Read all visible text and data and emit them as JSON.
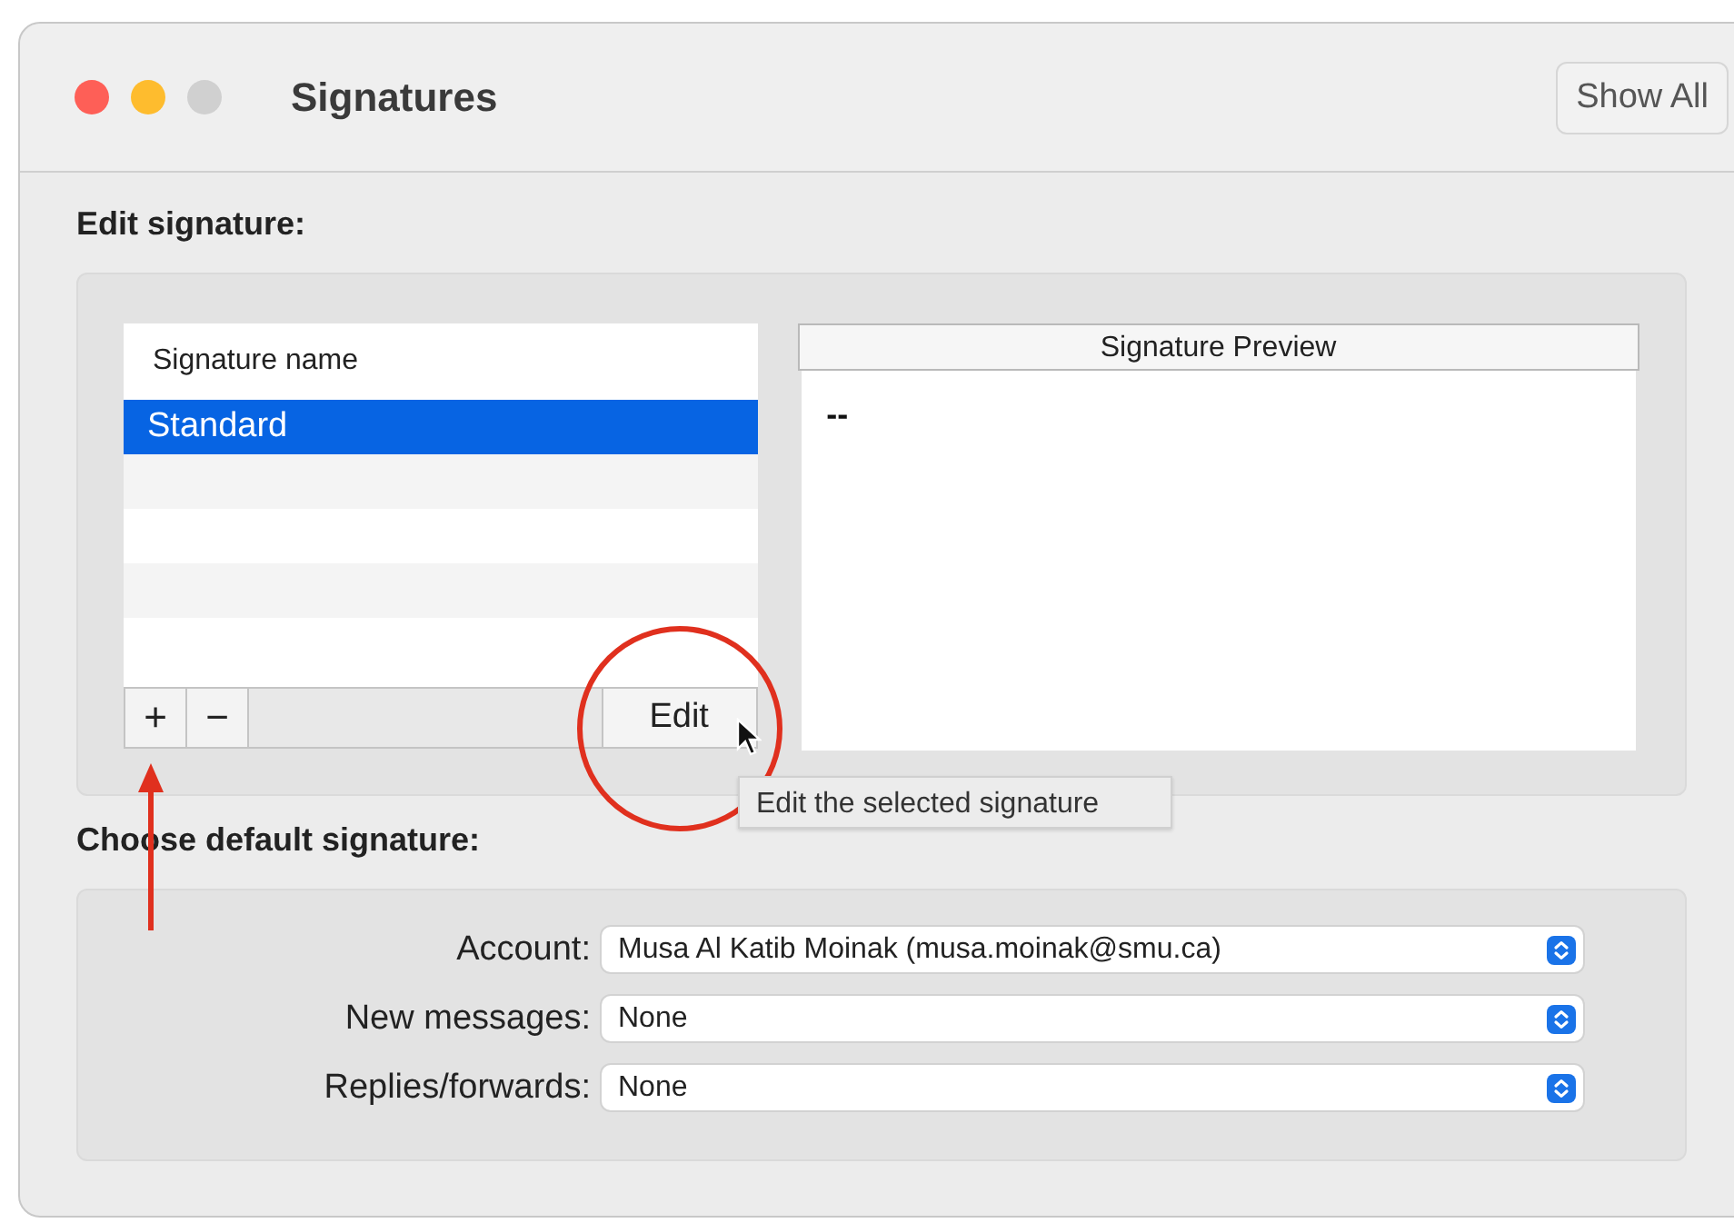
{
  "window": {
    "title": "Signatures",
    "show_all": "Show All"
  },
  "edit_section": {
    "heading": "Edit signature:",
    "list_header": "Signature name",
    "signatures": [
      {
        "name": "Standard",
        "selected": true
      }
    ],
    "add_button": "+",
    "remove_button": "−",
    "edit_button": "Edit",
    "preview_header": "Signature Preview",
    "preview_text": "--",
    "tooltip": "Edit the selected signature"
  },
  "default_section": {
    "heading": "Choose default signature:",
    "fields": [
      {
        "label": "Account:",
        "value": "Musa Al Katib Moinak (musa.moinak@smu.ca)"
      },
      {
        "label": "New messages:",
        "value": "None"
      },
      {
        "label": "Replies/forwards:",
        "value": "None"
      }
    ]
  }
}
